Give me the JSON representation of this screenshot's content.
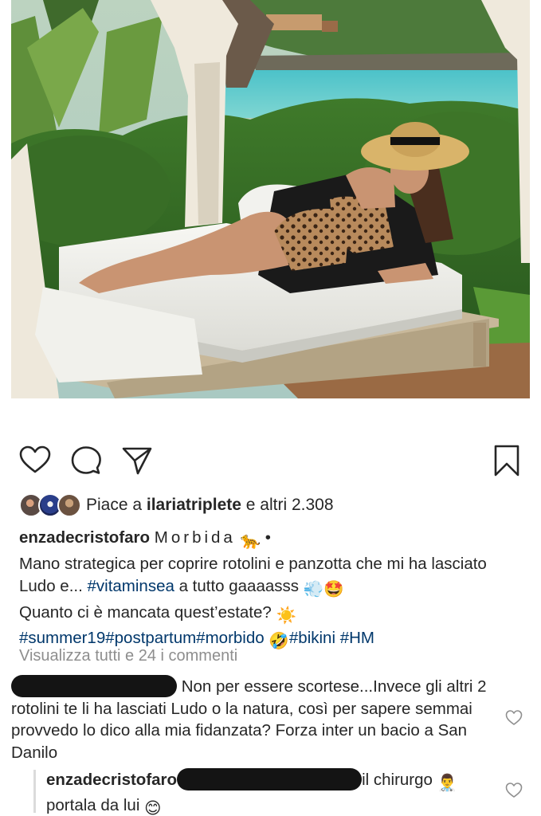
{
  "post": {
    "image_alt": "Woman in leopard bikini and straw hat lounging on a white daybed by the sea",
    "likes": {
      "prefix": "Piace a ",
      "user": "ilariatriplete",
      "suffix": " e altri 2.308"
    },
    "caption": {
      "username": "enzadecristofaro",
      "title": "Morbida",
      "title_emoji": "🐆",
      "bullet": "•",
      "text1": "Mano strategica per coprire rotolini e panzotta che mi ha lasciato Ludo e... ",
      "tag_vitaminsea": "#vitaminsea",
      "text2": " a tutto gaaaasss ",
      "emoji_dash": "💨",
      "emoji_starstruck": "🤩",
      "text3": "Quanto ci è mancata quest’estate? ",
      "emoji_sun": "☀️",
      "tags_line": "#summer19#postpartum#morbido",
      "emoji_laugh": "🤣",
      "tag_bikini": "#bikini",
      "tag_hm": "#HM"
    },
    "view_all_comments": "Visualizza tutti e 24 i commenti",
    "comments": [
      {
        "username_redacted": true,
        "text": "Non per essere scortese...Invece gli altri 2 rotolini te li ha lasciati Ludo o la natura, così per sapere semmai provvedo lo dico alla mia fidanzata? Forza inter un bacio a San Danilo"
      },
      {
        "username": "enzadecristofaro",
        "text_after_redaction": "il chirurgo ",
        "emoji_doctor": "👨‍⚕️",
        "text2": "portala da lui ",
        "emoji_smile": "😊"
      }
    ]
  },
  "icons": {
    "like": "heart-icon",
    "comment": "comment-bubble-icon",
    "share": "paper-plane-icon",
    "save": "bookmark-icon"
  }
}
